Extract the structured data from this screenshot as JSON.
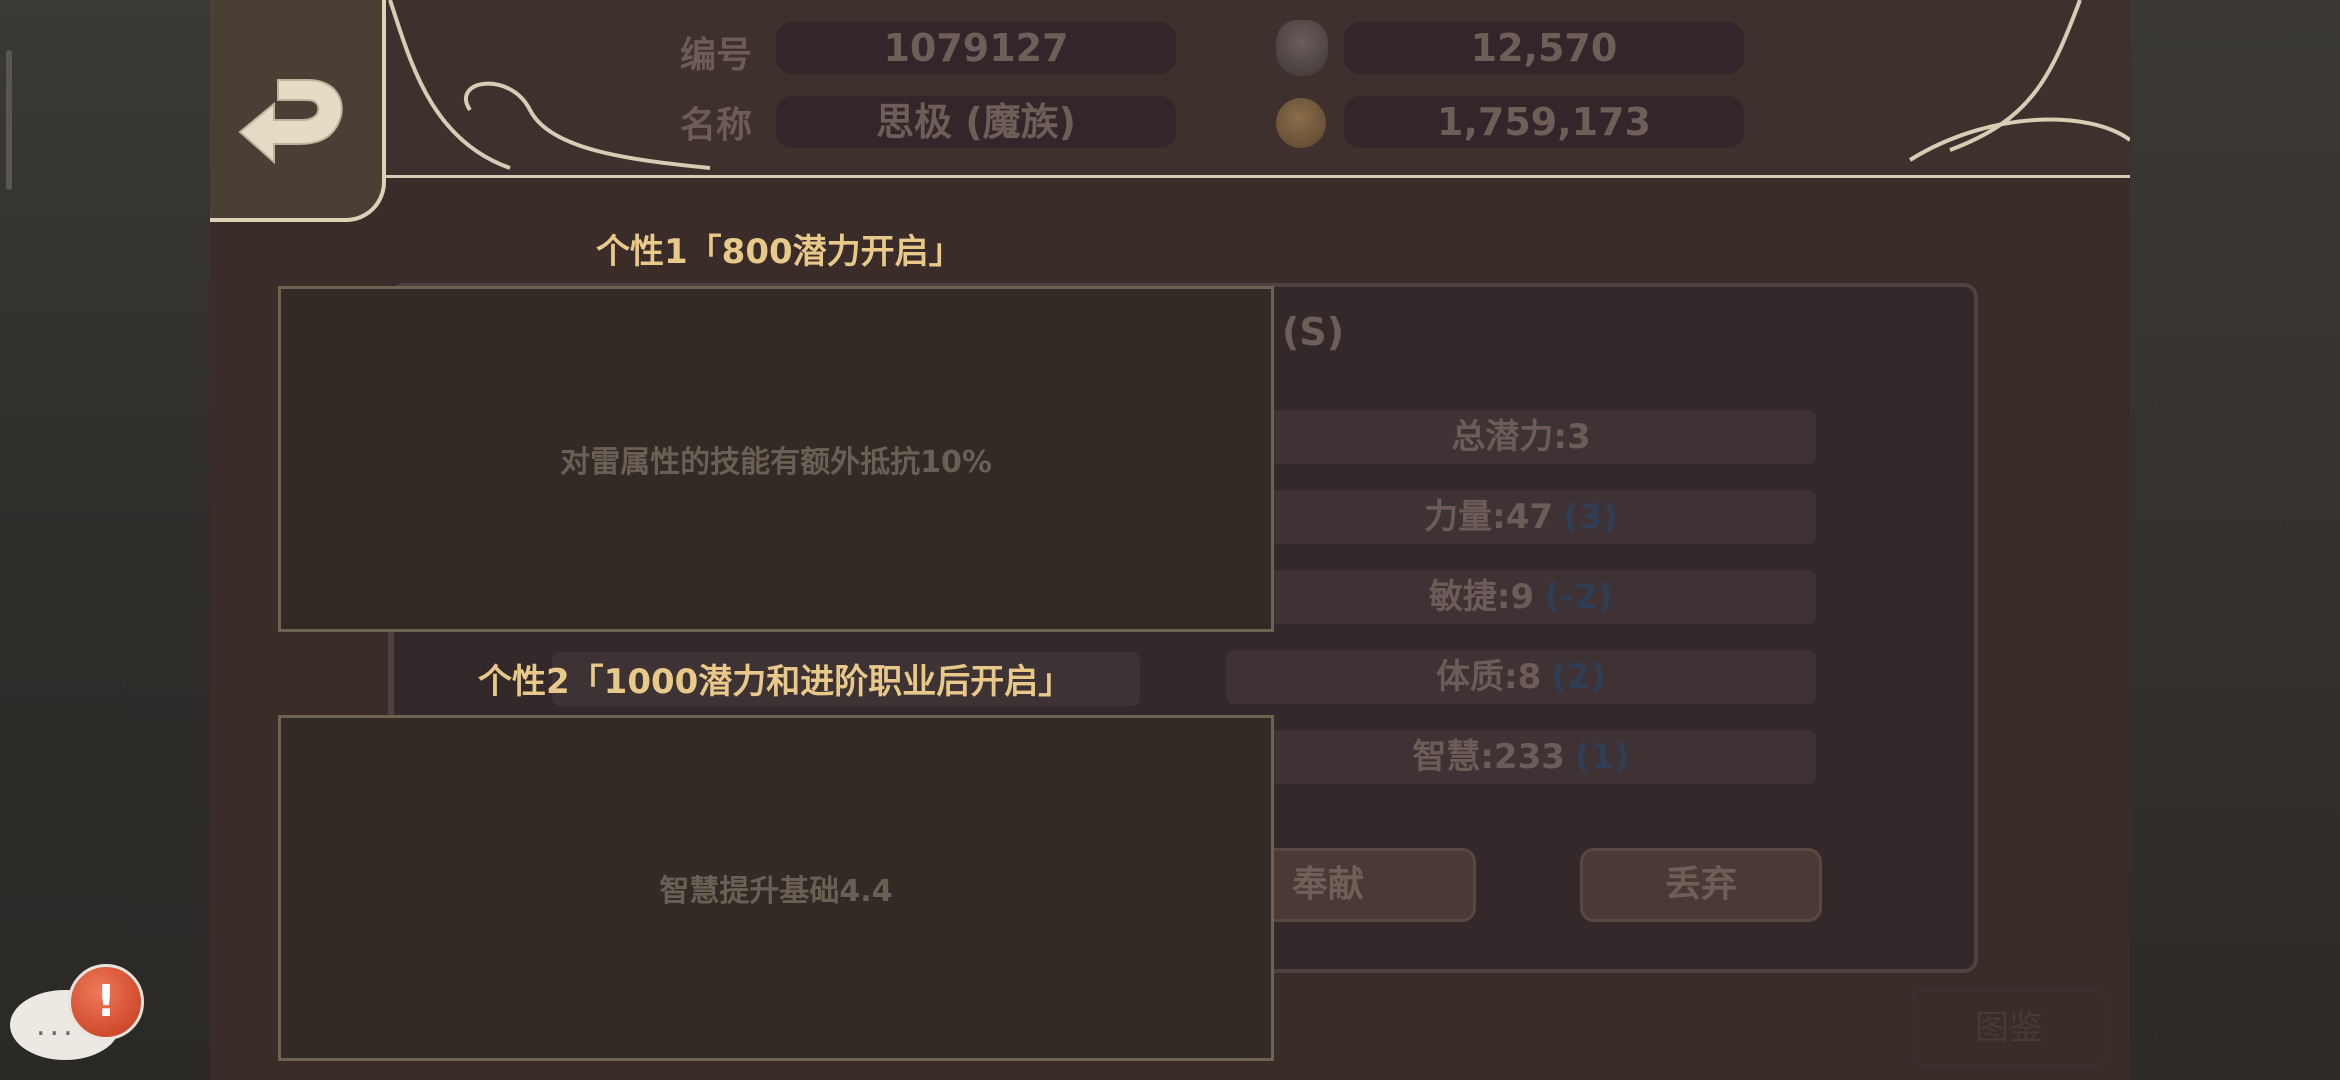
{
  "header": {
    "id_label": "编号",
    "id_value": "1079127",
    "name_label": "名称",
    "name_value": "思极 (魔族)",
    "gems_value": "12,570",
    "coins_value": "1,759,173",
    "gem_icon": "gem-icon",
    "coin_icon": "coin-icon",
    "back_icon": "back-arrow-icon"
  },
  "character": {
    "grade": "(S)",
    "total_potential": "总潜力:3",
    "stats": [
      {
        "label": "力量:47",
        "delta": "(3)"
      },
      {
        "label": "敏捷:9",
        "delta": "(-2)"
      },
      {
        "label": "体质:8",
        "delta": "(2)"
      },
      {
        "label": "智慧:233",
        "delta": "(1)"
      }
    ]
  },
  "actions": {
    "contribute": "奉献",
    "discard": "丢弃",
    "corner": "图鉴"
  },
  "traits": [
    {
      "title": "个性1「800潜力开启」",
      "desc": "对雷属性的技能有额外抵抗10%"
    },
    {
      "title": "个性2「1000潜力和进阶职业后开启」",
      "desc": "智慧提升基础4.4"
    }
  ],
  "chat": {
    "dots": "...",
    "alert": "!"
  },
  "colors": {
    "accent": "#e8c98a",
    "panel": "#33292b",
    "trait_border": "#6e6250"
  }
}
